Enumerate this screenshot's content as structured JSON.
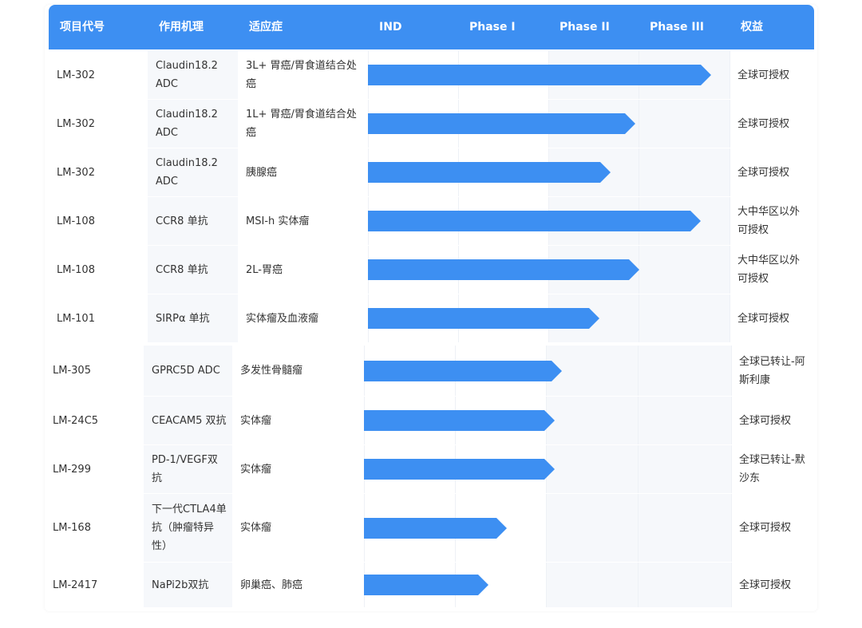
{
  "header": {
    "code": "项目代号",
    "mechanism": "作用机理",
    "indication": "适应症",
    "stages": [
      "IND",
      "Phase I",
      "Phase II",
      "Phase III"
    ],
    "rights": "权益"
  },
  "colors": {
    "header_bg": "#3d8ff2",
    "bar": "#3d8ff2"
  },
  "rows": [
    {
      "code": "LM-302",
      "mechanism": "Claudin18.2 ADC",
      "indication": "3L+ 胃癌/胃食道结合处癌",
      "rights": "全球可授权",
      "stage_progress": 0.95
    },
    {
      "code": "LM-302",
      "mechanism": "Claudin18.2 ADC",
      "indication": "1L+ 胃癌/胃食道结合处癌",
      "rights": "全球可授权",
      "stage_progress": 0.74
    },
    {
      "code": "LM-302",
      "mechanism": "Claudin18.2 ADC",
      "indication": "胰腺癌",
      "rights": "全球可授权",
      "stage_progress": 0.67
    },
    {
      "code": "LM-108",
      "mechanism": "CCR8 单抗",
      "indication": "MSI-h 实体瘤",
      "rights": "大中华区以外可授权",
      "stage_progress": 0.92
    },
    {
      "code": "LM-108",
      "mechanism": "CCR8 单抗",
      "indication": "2L-胃癌",
      "rights": "大中华区以外可授权",
      "stage_progress": 0.75
    },
    {
      "code": "LM-101",
      "mechanism": "SIRPα 单抗",
      "indication": "实体瘤及血液瘤",
      "rights": "全球可授权",
      "stage_progress": 0.64
    },
    {
      "code": "LM-305",
      "mechanism": "GPRC5D ADC",
      "indication": "多发性骨髓瘤",
      "rights": "全球已转让-阿斯利康",
      "stage_progress": 0.54
    },
    {
      "code": "LM-24C5",
      "mechanism": "CEACAM5 双抗",
      "indication": "实体瘤",
      "rights": "全球可授权",
      "stage_progress": 0.52
    },
    {
      "code": "LM-299",
      "mechanism": "PD-1/VEGF双抗",
      "indication": "实体瘤",
      "rights": "全球已转让-默沙东",
      "stage_progress": 0.52
    },
    {
      "code": "LM-168",
      "mechanism": "下一代CTLA4单抗（肿瘤特异性）",
      "indication": "实体瘤",
      "rights": "全球可授权",
      "stage_progress": 0.39
    },
    {
      "code": "LM-2417",
      "mechanism": "NaPi2b双抗",
      "indication": "卵巢癌、肺癌",
      "rights": "全球可授权",
      "stage_progress": 0.34
    }
  ]
}
